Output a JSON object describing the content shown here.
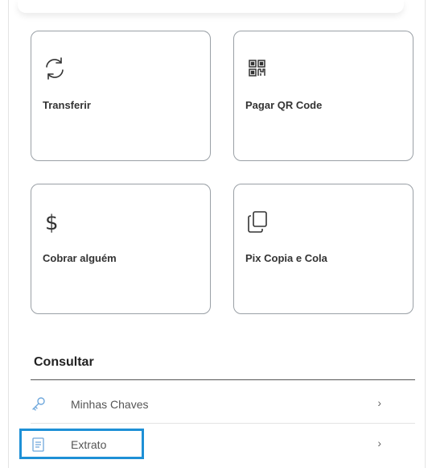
{
  "cards": [
    {
      "id": "transfer",
      "label": "Transferir",
      "icon": "transfer-icon"
    },
    {
      "id": "qr",
      "label": "Pagar QR Code",
      "icon": "qr-code-icon"
    },
    {
      "id": "charge",
      "label": "Cobrar alguém",
      "icon": "dollar-icon"
    },
    {
      "id": "copy",
      "label": "Pix Copia e Cola",
      "icon": "copy-icon"
    }
  ],
  "section": {
    "title": "Consultar"
  },
  "list": [
    {
      "label": "Minhas Chaves",
      "icon": "key-icon",
      "chevron": "›"
    },
    {
      "label": "Extrato",
      "icon": "document-icon",
      "chevron": "›"
    }
  ],
  "colors": {
    "highlight": "#1e90d6",
    "icon_key": "#6fa8dc",
    "icon_doc": "#6fa8dc"
  }
}
